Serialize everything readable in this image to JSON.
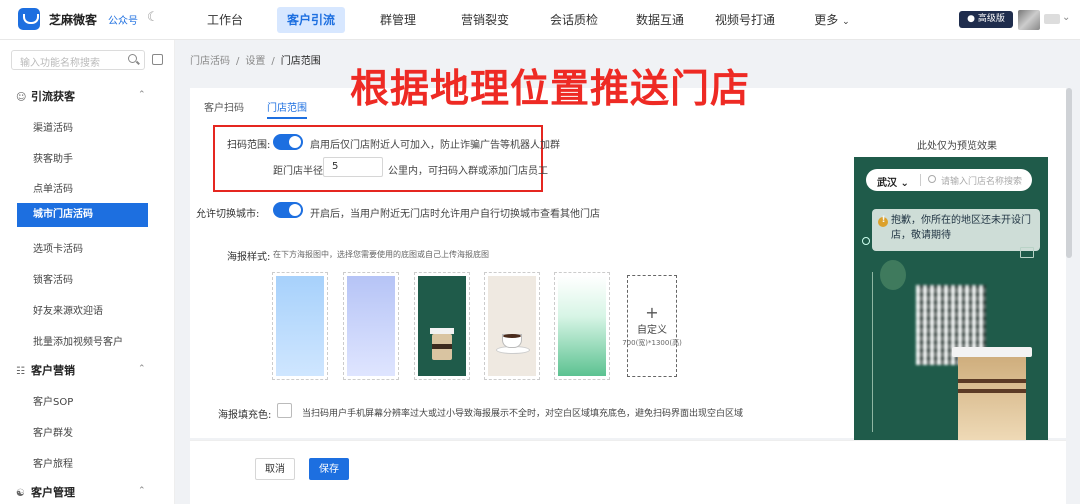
{
  "header": {
    "brand": "芝麻微客",
    "brand_sub": "公众号",
    "nav": [
      "工作台",
      "客户引流",
      "群管理",
      "营销裂变",
      "会话质检",
      "数据互通",
      "视频号打通",
      "更多"
    ],
    "active_nav": "客户引流",
    "badge": "高级版"
  },
  "sidebar": {
    "search_placeholder": "输入功能名称搜索",
    "groups": [
      {
        "label": "引流获客",
        "items": [
          "渠道活码",
          "获客助手",
          "点单活码",
          "城市门店活码",
          "选项卡活码",
          "锁客活码",
          "好友来源欢迎语",
          "批量添加视频号客户"
        ]
      },
      {
        "label": "客户营销",
        "items": [
          "客户SOP",
          "客户群发",
          "客户旅程"
        ]
      },
      {
        "label": "客户管理",
        "items": []
      }
    ],
    "active_item": "城市门店活码"
  },
  "breadcrumb": [
    "门店活码",
    "设置",
    "门店范围"
  ],
  "tabs": [
    "客户扫码",
    "门店范围"
  ],
  "active_tab": "门店范围",
  "headline": "根据地理位置推送门店",
  "form": {
    "scan_range_label": "扫码范围:",
    "scan_range_hint": "启用后仅门店附近人可加入，防止诈骗广告等机器人加群",
    "radius_label": "距门店半径",
    "radius_value": "5",
    "radius_hint": "公里内，可扫码入群或添加门店员工",
    "switch_city_label": "允许切换城市:",
    "switch_city_hint": "开启后，当用户附近无门店时允许用户自行切换城市查看其他门店",
    "poster_style_label": "海报样式:",
    "poster_style_hint": "在下方海报图中，选择您需要使用的底图或自己上传海报底图",
    "custom_label": "自定义",
    "custom_size": "700(宽)*1300(高)",
    "fill_label": "海报填充色:",
    "fill_hint": "当扫码用户手机屏幕分辨率过大或过小导致海报展示不全时，对空白区域填充底色，避免扫码界面出现空白区域"
  },
  "buttons": {
    "cancel": "取消",
    "save": "保存"
  },
  "preview": {
    "title": "此处仅为预览效果",
    "city": "武汉",
    "search_placeholder": "请输入门店名称搜索",
    "notice": "抱歉，你所在的地区还未开设门店，敬请期待"
  },
  "colors": {
    "accent": "#1d6fe0",
    "headline": "#ee2a24",
    "poster_green": "#1f5b4a"
  },
  "icons": [
    "search-icon",
    "sidebar-toggle-icon",
    "moon-icon",
    "chevron-down-icon",
    "user-plus-icon",
    "list-icon",
    "people-icon",
    "warning-icon",
    "plus-icon",
    "edit-icon"
  ]
}
